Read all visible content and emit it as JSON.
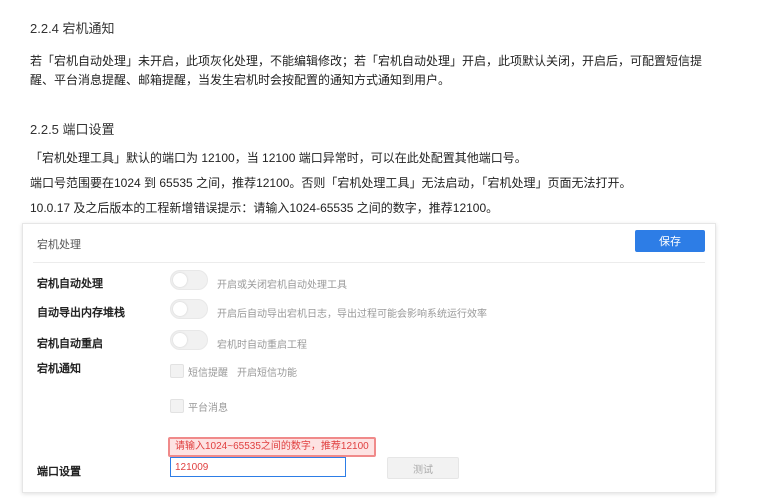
{
  "section_224": {
    "heading": "2.2.4 宕机通知",
    "line1": "若「宕机自动处理」未开启，此项灰化处理，不能编辑修改；若「宕机自动处理」开启，此项默认关闭，开启后，可配置短信提",
    "line2": "醒、平台消息提醒、邮箱提醒，当发生宕机时会按配置的通知方式通知到用户。"
  },
  "section_225": {
    "heading": "2.2.5 端口设置",
    "line1": "「宕机处理工具」默认的端口为 12100，当 12100 端口异常时，可以在此处配置其他端口号。",
    "line2": "端口号范围要在1024 到 65535 之间，推荐12100。否则「宕机处理工具」无法启动，「宕机处理」页面无法打开。",
    "line3": "10.0.17 及之后版本的工程新增错误提示：请输入1024-65535 之间的数字，推荐12100。"
  },
  "panel": {
    "title": "宕机处理",
    "save_label": "保存",
    "rows": [
      {
        "label": "宕机自动处理",
        "desc": "开启或关闭宕机自动处理工具"
      },
      {
        "label": "自动导出内存堆栈",
        "desc": "开启后自动导出宕机日志，导出过程可能会影响系统运行效率"
      },
      {
        "label": "宕机自动重启",
        "desc": "宕机时自动重启工程"
      }
    ],
    "notify_label": "宕机通知",
    "sms_label": "短信提醒",
    "sms_action": "开启短信功能",
    "platform_label": "平台消息",
    "error_text": "请输入1024~65535之间的数字，推荐12100",
    "port_label": "端口设置",
    "port_value": "121009",
    "test_label": "测试"
  },
  "colors": {
    "primary": "#2d7de6",
    "error": "#e04040"
  }
}
